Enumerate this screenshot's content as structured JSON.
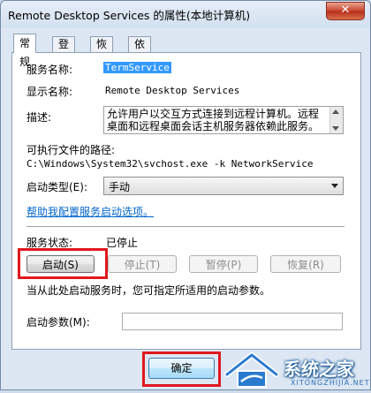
{
  "window": {
    "title": "Remote Desktop Services 的属性(本地计算机)",
    "close_glyph": "✕"
  },
  "tabs": [
    {
      "label": "常规"
    },
    {
      "label": "登录"
    },
    {
      "label": "恢复"
    },
    {
      "label": "依存关系"
    }
  ],
  "general": {
    "service_name_label": "服务名称:",
    "service_name_value": "TermService",
    "display_name_label": "显示名称:",
    "display_name_value": "Remote Desktop Services",
    "description_label": "描述:",
    "description_value": "允许用户以交互方式连接到远程计算机。远程桌面和远程桌面会话主机服务器依赖此服务。",
    "exe_path_label": "可执行文件的路径:",
    "exe_path_value": "C:\\Windows\\System32\\svchost.exe -k NetworkService",
    "startup_type_label": "启动类型(E):",
    "startup_type_value": "手动",
    "help_link": "帮助我配置服务启动选项。",
    "status_label": "服务状态:",
    "status_value": "已停止",
    "buttons": {
      "start": "启动(S)",
      "stop": "停止(T)",
      "pause": "暂停(P)",
      "resume": "恢复(R)"
    },
    "hint_text": "当从此处启动服务时，您可指定所适用的启动参数。",
    "start_params_label": "启动参数(M):",
    "start_params_value": ""
  },
  "footer": {
    "ok_label": "确定"
  },
  "watermark": {
    "logo_text": "系统之家",
    "sub_text": "XITONGZHIJIA.NET"
  },
  "colors": {
    "highlight": "#3399ff",
    "annotation_red": "#e0171d",
    "link": "#0066cc"
  }
}
